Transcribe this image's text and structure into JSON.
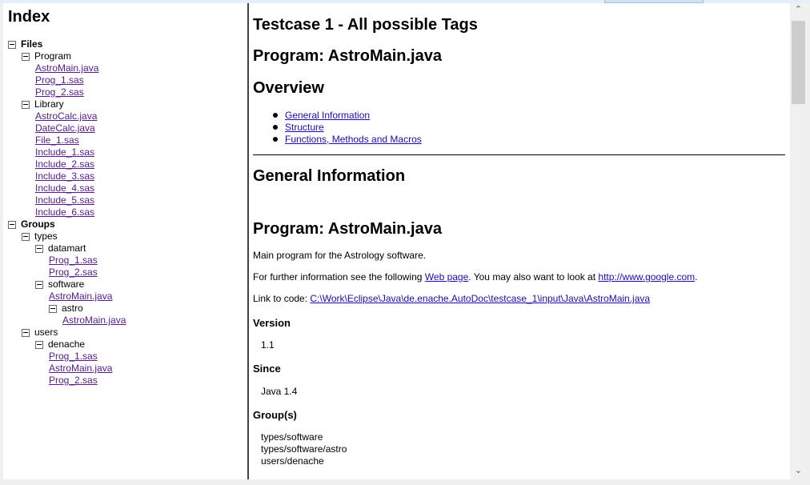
{
  "index": {
    "title": "Index",
    "tree": [
      {
        "label": "Files",
        "kind": "group",
        "bold": true,
        "depth": 0
      },
      {
        "label": "Program",
        "kind": "group",
        "depth": 1
      },
      {
        "label": "AstroMain.java",
        "kind": "link",
        "depth": 2
      },
      {
        "label": "Prog_1.sas",
        "kind": "link",
        "depth": 2
      },
      {
        "label": "Prog_2.sas",
        "kind": "link",
        "depth": 2
      },
      {
        "label": "Library",
        "kind": "group",
        "depth": 1
      },
      {
        "label": "AstroCalc.java",
        "kind": "link",
        "depth": 2
      },
      {
        "label": "DateCalc.java",
        "kind": "link",
        "depth": 2
      },
      {
        "label": "File_1.sas",
        "kind": "link",
        "depth": 2
      },
      {
        "label": "Include_1.sas",
        "kind": "link",
        "depth": 2
      },
      {
        "label": "Include_2.sas",
        "kind": "link",
        "depth": 2
      },
      {
        "label": "Include_3.sas",
        "kind": "link",
        "depth": 2
      },
      {
        "label": "Include_4.sas",
        "kind": "link",
        "depth": 2
      },
      {
        "label": "Include_5.sas",
        "kind": "link",
        "depth": 2
      },
      {
        "label": "Include_6.sas",
        "kind": "link",
        "depth": 2
      },
      {
        "label": "Groups",
        "kind": "group",
        "bold": true,
        "depth": 0
      },
      {
        "label": "types",
        "kind": "group",
        "depth": 1
      },
      {
        "label": "datamart",
        "kind": "group",
        "depth": 2
      },
      {
        "label": "Prog_1.sas",
        "kind": "link",
        "depth": 3
      },
      {
        "label": "Prog_2.sas",
        "kind": "link",
        "depth": 3
      },
      {
        "label": "software",
        "kind": "group",
        "depth": 2
      },
      {
        "label": "AstroMain.java",
        "kind": "link",
        "depth": 3
      },
      {
        "label": "astro",
        "kind": "group",
        "depth": 3
      },
      {
        "label": "AstroMain.java",
        "kind": "link",
        "depth": 4
      },
      {
        "label": "users",
        "kind": "group",
        "depth": 1
      },
      {
        "label": "denache",
        "kind": "group",
        "depth": 2
      },
      {
        "label": "Prog_1.sas",
        "kind": "link",
        "depth": 3
      },
      {
        "label": "AstroMain.java",
        "kind": "link",
        "depth": 3
      },
      {
        "label": "Prog_2.sas",
        "kind": "link",
        "depth": 3
      }
    ]
  },
  "doc": {
    "title": "Testcase 1 - All possible Tags",
    "program_heading": "Program: AstroMain.java",
    "overview_heading": "Overview",
    "overview_links": [
      "General Information",
      "Structure",
      "Functions, Methods and Macros"
    ],
    "general_heading": "General Information",
    "program_heading2": "Program: AstroMain.java",
    "description": "Main program for the Astrology software.",
    "further_prefix": "For further information see the following",
    "web_page_link": "Web page",
    "further_middle": ". You may also want to look at",
    "google_link": "http://www.google.com",
    "further_suffix": ".",
    "link_prefix": "Link to code:",
    "code_link": "C:\\Work\\Eclipse\\Java\\de.enache.AutoDoc\\testcase_1\\input\\Java\\AstroMain.java",
    "version_label": "Version",
    "version_value": "1.1",
    "since_label": "Since",
    "since_value": "Java 1.4",
    "groups_label": "Group(s)",
    "groups_values": [
      "types/software",
      "types/software/astro",
      "users/denache"
    ]
  }
}
